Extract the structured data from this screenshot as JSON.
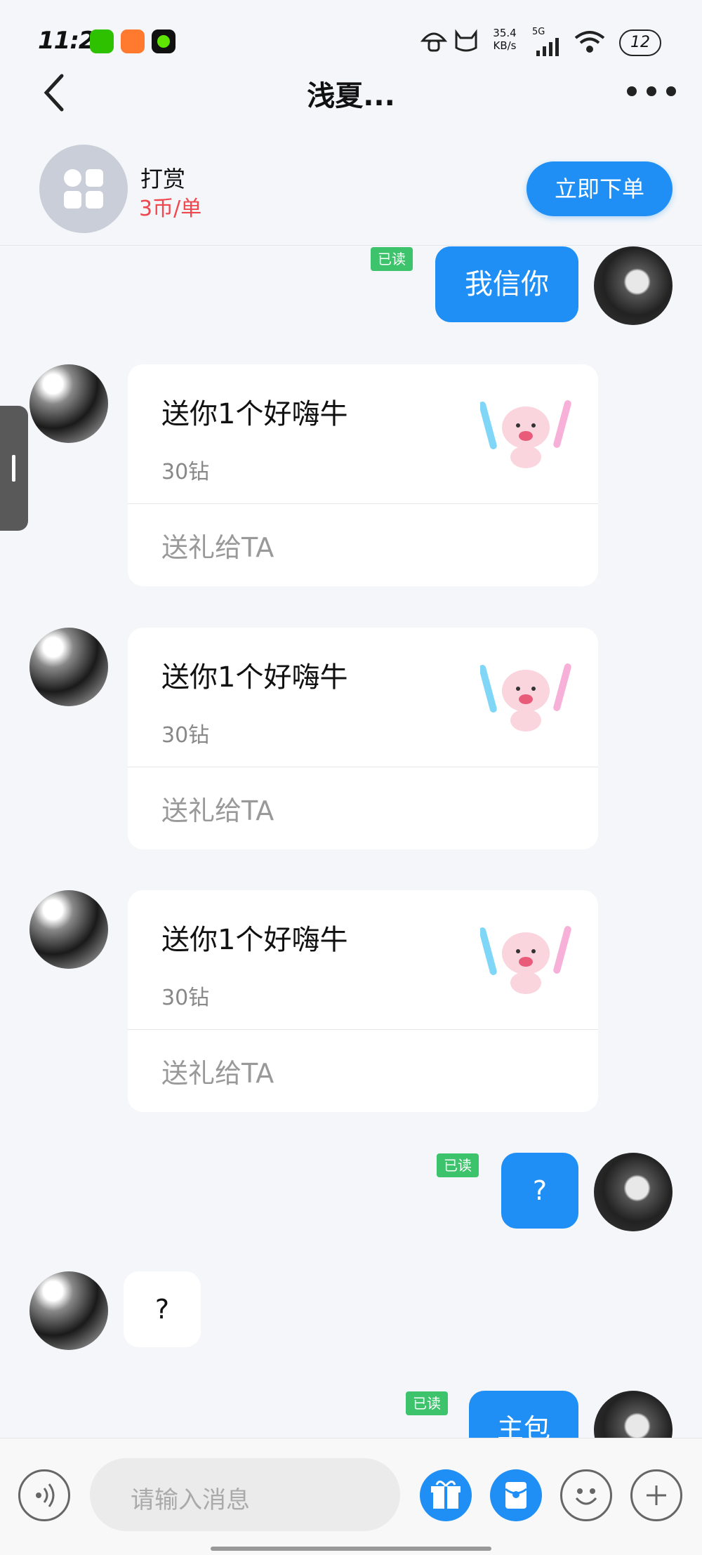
{
  "status_bar": {
    "time": "11:23",
    "net_speed": "35.4 KB/s",
    "network": "5G",
    "battery": "12"
  },
  "header": {
    "title": "浅夏..."
  },
  "order_bar": {
    "service_name": "打赏",
    "price": "3币/单",
    "order_button": "立即下单"
  },
  "messages": {
    "read_label": "已读",
    "m1_text": "我信你",
    "gift_title": "送你1个好嗨牛",
    "gift_price": "30钻",
    "gift_action": "送礼给TA",
    "m5_text": "?",
    "m6_text": "?",
    "m7_text": "主包"
  },
  "input_bar": {
    "placeholder": "请输入消息"
  },
  "colors": {
    "accent": "#1f8ff5",
    "read_badge": "#3cc36b",
    "price": "#f0474f"
  }
}
